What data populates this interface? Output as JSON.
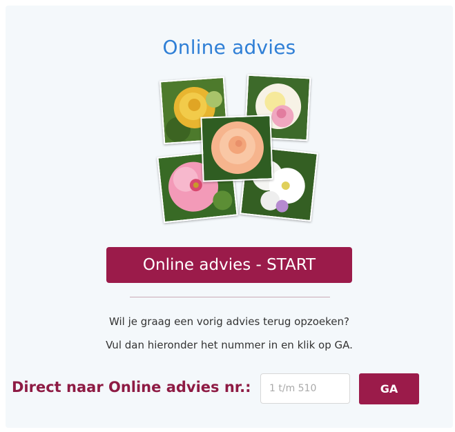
{
  "widget": {
    "title": "Online advies",
    "start_button_label": "Online advies - START",
    "help_line_1": "Wil je graag een vorig advies terug opzoeken?",
    "help_line_2": "Vul dan hieronder het nummer in en klik op GA.",
    "direct_label": "Direct naar Online advies nr.:",
    "number_input": {
      "value": "",
      "placeholder": "1 t/m 510"
    },
    "go_button_label": "GA"
  },
  "colors": {
    "title": "#2f7fd6",
    "button_bg": "#9b1b4a",
    "label": "#8e1b44",
    "card_bg": "#f4f8fb"
  },
  "collage": {
    "photos": [
      "yellow-rose",
      "white-pink-rose",
      "peach-rose",
      "pink-rose",
      "white-roses-cluster"
    ]
  }
}
